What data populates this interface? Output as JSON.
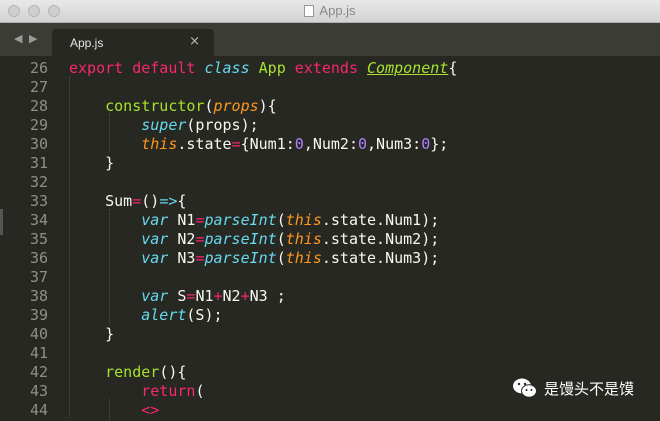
{
  "window": {
    "title": "App.js"
  },
  "tabbar": {
    "back_glyph": "◀",
    "forward_glyph": "▶",
    "tab_label": "App.js",
    "close_glyph": "×"
  },
  "code_lines": [
    {
      "num": "26",
      "tokens": [
        [
          "kw",
          "export"
        ],
        [
          "pl",
          " "
        ],
        [
          "kw",
          "default"
        ],
        [
          "pl",
          " "
        ],
        [
          "sto",
          "class"
        ],
        [
          "pl",
          " "
        ],
        [
          "cls",
          "App"
        ],
        [
          "pl",
          " "
        ],
        [
          "kw",
          "extends"
        ],
        [
          "pl",
          " "
        ],
        [
          "inh",
          "Component"
        ],
        [
          "pl",
          "{"
        ]
      ]
    },
    {
      "num": "27",
      "tokens": []
    },
    {
      "num": "28",
      "tokens": [
        [
          "pl",
          "    "
        ],
        [
          "fn",
          "constructor"
        ],
        [
          "pl",
          "("
        ],
        [
          "par",
          "props"
        ],
        [
          "pl",
          "){"
        ]
      ]
    },
    {
      "num": "29",
      "tokens": [
        [
          "pl",
          "        "
        ],
        [
          "sto",
          "super"
        ],
        [
          "pl",
          "(props);"
        ]
      ]
    },
    {
      "num": "30",
      "tokens": [
        [
          "pl",
          "        "
        ],
        [
          "var",
          "this"
        ],
        [
          "pl",
          ".state"
        ],
        [
          "op",
          "="
        ],
        [
          "pl",
          "{Num1:"
        ],
        [
          "num",
          "0"
        ],
        [
          "pl",
          ",Num2:"
        ],
        [
          "num",
          "0"
        ],
        [
          "pl",
          ",Num3:"
        ],
        [
          "num",
          "0"
        ],
        [
          "pl",
          "};"
        ]
      ]
    },
    {
      "num": "31",
      "tokens": [
        [
          "pl",
          "    }"
        ]
      ]
    },
    {
      "num": "32",
      "tokens": []
    },
    {
      "num": "33",
      "tokens": [
        [
          "pl",
          "    Sum"
        ],
        [
          "op",
          "="
        ],
        [
          "pl",
          "()"
        ],
        [
          "sto",
          "=>"
        ],
        [
          "pl",
          "{"
        ]
      ]
    },
    {
      "num": "34",
      "tokens": [
        [
          "pl",
          "        "
        ],
        [
          "sto",
          "var"
        ],
        [
          "pl",
          " N1"
        ],
        [
          "op",
          "="
        ],
        [
          "sto",
          "parseInt"
        ],
        [
          "pl",
          "("
        ],
        [
          "var",
          "this"
        ],
        [
          "pl",
          ".state.Num1);"
        ]
      ]
    },
    {
      "num": "35",
      "tokens": [
        [
          "pl",
          "        "
        ],
        [
          "sto",
          "var"
        ],
        [
          "pl",
          " N2"
        ],
        [
          "op",
          "="
        ],
        [
          "sto",
          "parseInt"
        ],
        [
          "pl",
          "("
        ],
        [
          "var",
          "this"
        ],
        [
          "pl",
          ".state.Num2);"
        ]
      ]
    },
    {
      "num": "36",
      "tokens": [
        [
          "pl",
          "        "
        ],
        [
          "sto",
          "var"
        ],
        [
          "pl",
          " N3"
        ],
        [
          "op",
          "="
        ],
        [
          "sto",
          "parseInt"
        ],
        [
          "pl",
          "("
        ],
        [
          "var",
          "this"
        ],
        [
          "pl",
          ".state.Num3);"
        ]
      ]
    },
    {
      "num": "37",
      "tokens": []
    },
    {
      "num": "38",
      "tokens": [
        [
          "pl",
          "        "
        ],
        [
          "sto",
          "var"
        ],
        [
          "pl",
          " S"
        ],
        [
          "op",
          "="
        ],
        [
          "pl",
          "N1"
        ],
        [
          "op",
          "+"
        ],
        [
          "pl",
          "N2"
        ],
        [
          "op",
          "+"
        ],
        [
          "pl",
          "N3 ;"
        ]
      ]
    },
    {
      "num": "39",
      "tokens": [
        [
          "pl",
          "        "
        ],
        [
          "sto",
          "alert"
        ],
        [
          "pl",
          "(S);"
        ]
      ]
    },
    {
      "num": "40",
      "tokens": [
        [
          "pl",
          "    }"
        ]
      ]
    },
    {
      "num": "41",
      "tokens": []
    },
    {
      "num": "42",
      "tokens": [
        [
          "pl",
          "    "
        ],
        [
          "fn",
          "render"
        ],
        [
          "pl",
          "(){"
        ]
      ]
    },
    {
      "num": "43",
      "tokens": [
        [
          "pl",
          "        "
        ],
        [
          "kw",
          "return"
        ],
        [
          "pl",
          "("
        ]
      ]
    },
    {
      "num": "44",
      "tokens": [
        [
          "pl",
          "        "
        ],
        [
          "op",
          "<>"
        ]
      ]
    }
  ],
  "watermark": {
    "text": "是馒头不是馍",
    "icon": "wechat-icon"
  },
  "colors": {
    "background": "#272822",
    "keyword": "#f92672",
    "storage": "#66d9ef",
    "function": "#a6e22e",
    "parameter": "#fd971f",
    "number": "#ae81ff",
    "text": "#f8f8f2",
    "line_number": "#8f908a"
  }
}
